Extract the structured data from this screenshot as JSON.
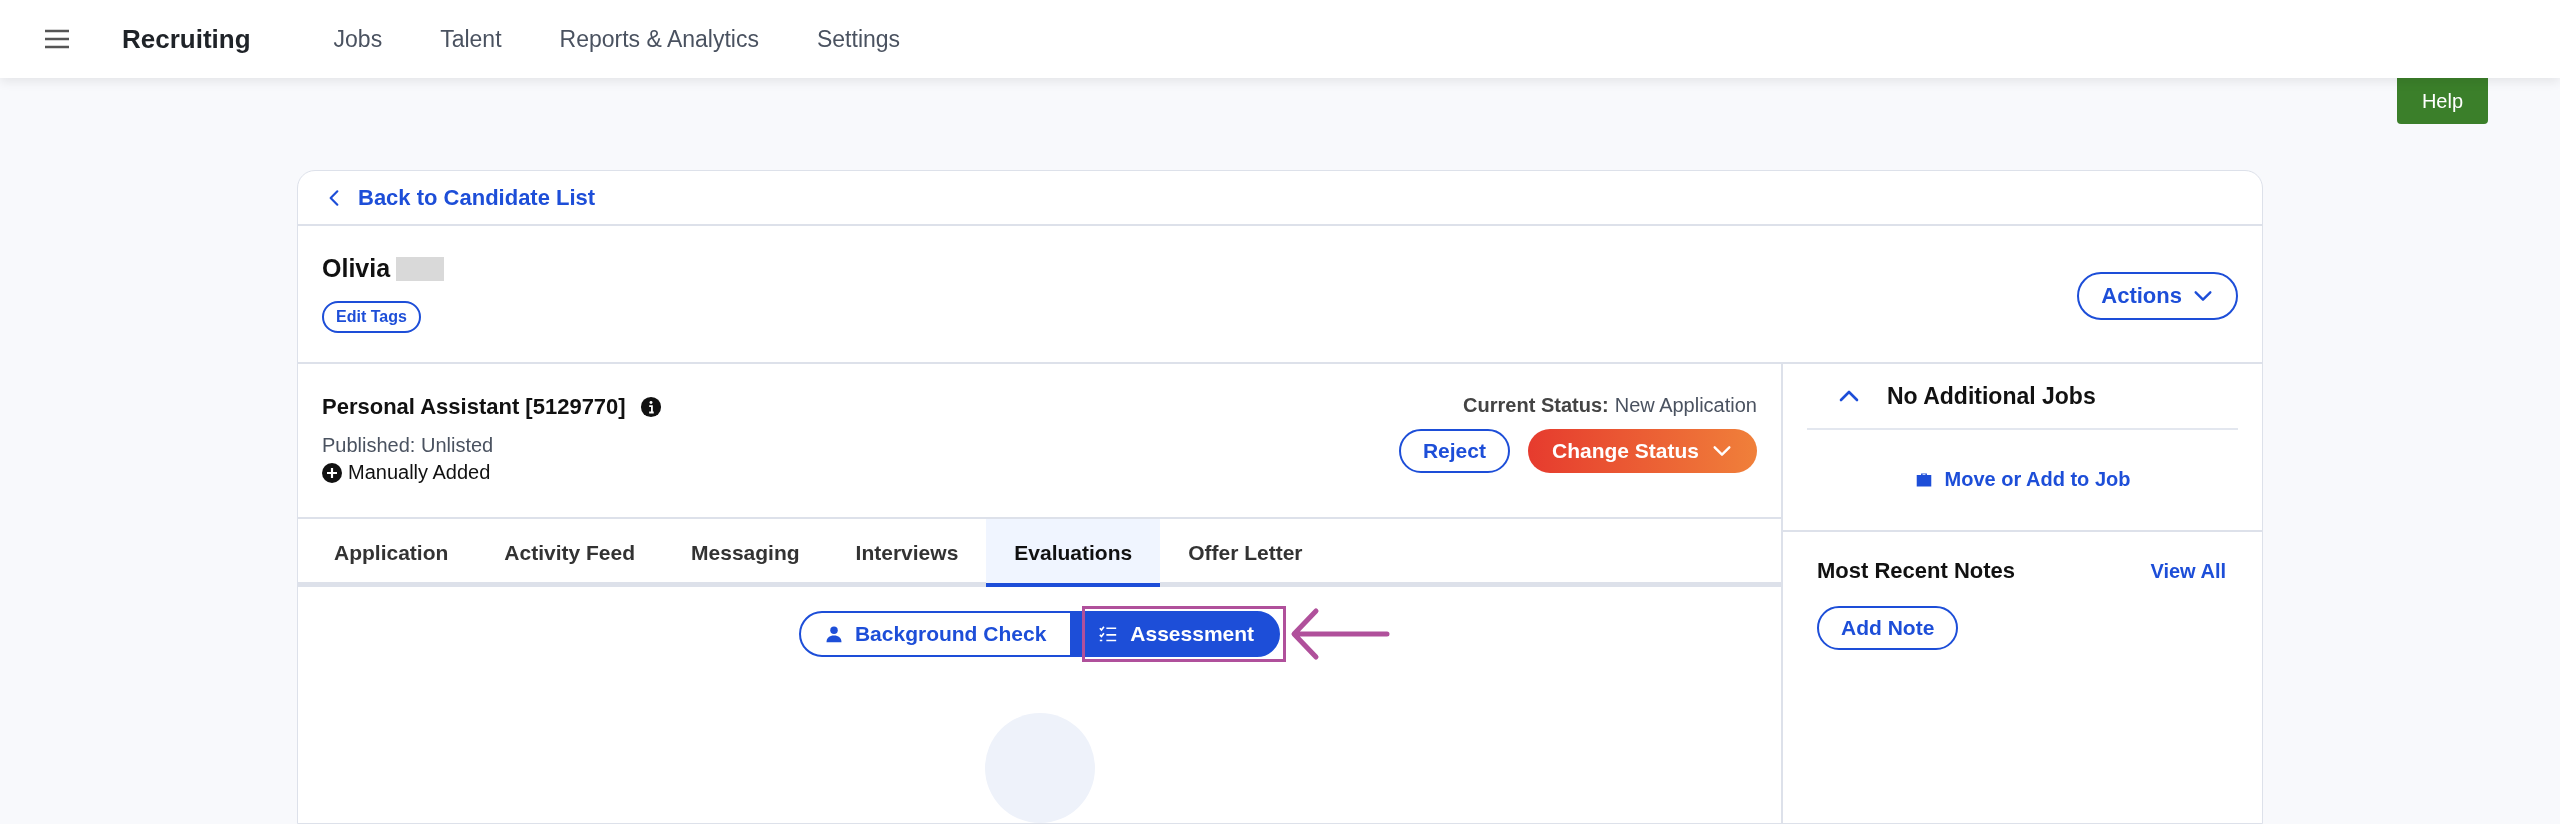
{
  "top_bar": {
    "app_title": "Recruiting",
    "nav": [
      {
        "label": "Jobs"
      },
      {
        "label": "Talent"
      },
      {
        "label": "Reports & Analytics"
      },
      {
        "label": "Settings"
      }
    ]
  },
  "help_button": "Help",
  "back_link": "Back to Candidate List",
  "candidate": {
    "first_name": "Olivia",
    "edit_tags": "Edit Tags",
    "actions": "Actions"
  },
  "job": {
    "title": "Personal Assistant [5129770]",
    "published": "Published: Unlisted",
    "source": "Manually Added",
    "status_label": "Current Status:",
    "status_value": "New Application",
    "reject": "Reject",
    "change_status": "Change Status"
  },
  "tabs": [
    {
      "label": "Application",
      "selected": false
    },
    {
      "label": "Activity Feed",
      "selected": false
    },
    {
      "label": "Messaging",
      "selected": false
    },
    {
      "label": "Interviews",
      "selected": false
    },
    {
      "label": "Evaluations",
      "selected": true
    },
    {
      "label": "Offer Letter",
      "selected": false
    }
  ],
  "evaluation_types": [
    {
      "label": "Background Check",
      "kind": "person",
      "selected": false
    },
    {
      "label": "Assessment",
      "kind": "checklist",
      "selected": true
    }
  ],
  "side_panel": {
    "jobs_header": "No Additional Jobs",
    "expanded": true,
    "move_link": "Move or Add to Job",
    "notes_title": "Most Recent Notes",
    "view_all": "View All",
    "add_note": "Add Note"
  }
}
